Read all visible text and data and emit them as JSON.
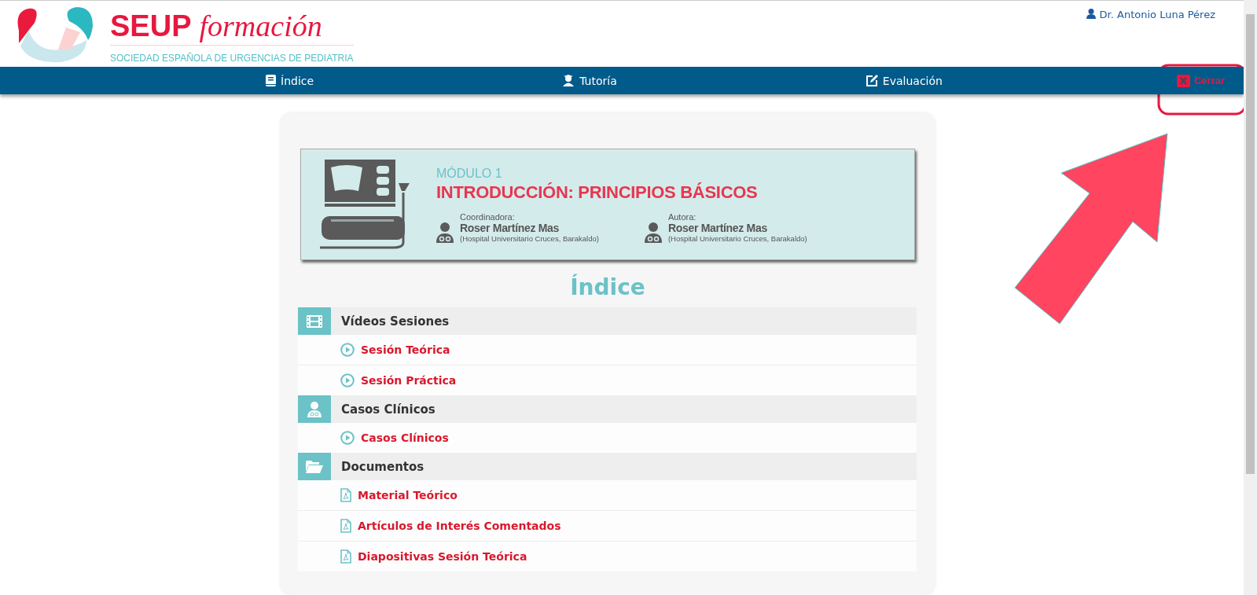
{
  "header": {
    "logo_title": "SEUP",
    "logo_script": "formación",
    "logo_subtitle": "SOCIEDAD ESPAÑOLA DE URGENCIAS DE PEDIATRIA",
    "user": "Dr. Antonio Luna Pérez"
  },
  "nav": {
    "items": [
      {
        "label": "Índice",
        "kind": "book"
      },
      {
        "label": "Tutoría",
        "kind": "teacher"
      },
      {
        "label": "Evaluación",
        "kind": "edit"
      }
    ],
    "close": "Cerrar"
  },
  "banner": {
    "module": "MÓDULO 1",
    "title": "INTRODUCCIÓN: PRINCIPIOS BÁSICOS",
    "people": [
      {
        "role": "Coordinadora:",
        "name": "Roser Martínez Mas",
        "affiliation": "(Hospital Universitario Cruces, Barakaldo)"
      },
      {
        "role": "Autora:",
        "name": "Roser Martínez Mas",
        "affiliation": "(Hospital Universitario Cruces, Barakaldo)"
      }
    ]
  },
  "index": {
    "title": "Índice",
    "sections": [
      {
        "title": "Vídeos Sesiones",
        "kind": "film",
        "items": [
          {
            "label": "Sesión Teórica",
            "kind": "video"
          },
          {
            "label": "Sesión Práctica",
            "kind": "video"
          }
        ]
      },
      {
        "title": "Casos Clínicos",
        "kind": "doctor",
        "items": [
          {
            "label": "Casos Clínicos",
            "kind": "video"
          }
        ]
      },
      {
        "title": "Documentos",
        "kind": "folder",
        "items": [
          {
            "label": "Material Teórico",
            "kind": "pdf"
          },
          {
            "label": "Artículos de Interés Comentados",
            "kind": "pdf"
          },
          {
            "label": "Diapositivas Sesión Teórica",
            "kind": "pdf"
          }
        ]
      }
    ]
  }
}
